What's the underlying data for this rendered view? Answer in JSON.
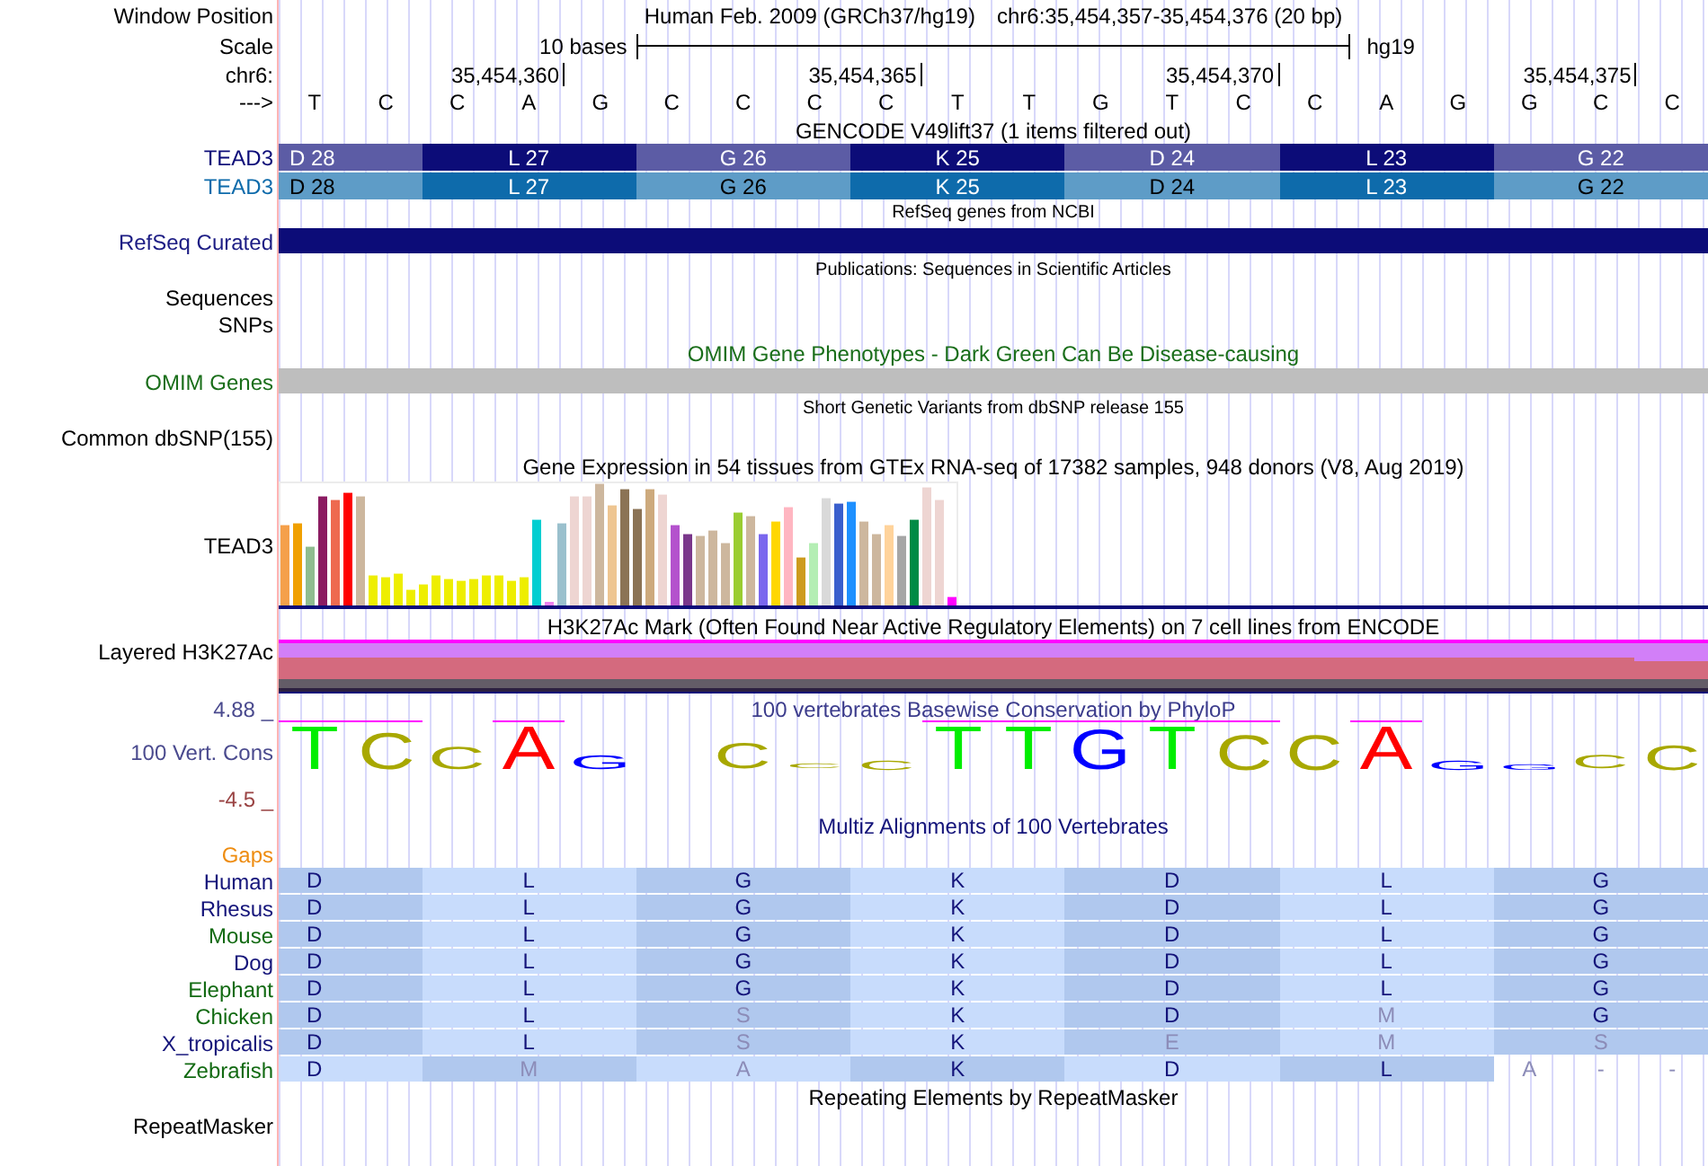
{
  "header": {
    "label": "Window Position",
    "assembly": "Human Feb. 2009 (GRCh37/hg19)",
    "position": "chr6:35,454,357-35,454,376 (20 bp)"
  },
  "scale": {
    "label": "Scale",
    "length": "10 bases",
    "genome": "hg19"
  },
  "coordinates": {
    "label": "chr6:",
    "ticks": [
      "35,454,360",
      "35,454,365",
      "35,454,370",
      "35,454,375"
    ]
  },
  "sequence": {
    "label": "--->",
    "bases": [
      "T",
      "C",
      "C",
      "A",
      "G",
      "C",
      "C",
      "C",
      "C",
      "T",
      "T",
      "G",
      "T",
      "C",
      "C",
      "A",
      "G",
      "G",
      "C",
      "C"
    ]
  },
  "gencode": {
    "title": "GENCODE V49lift37 (1 items filtered out)",
    "transcripts": [
      {
        "name": "TEAD3",
        "color": "#0c0c78",
        "codons": [
          "D 28",
          "L 27",
          "G 26",
          "K 25",
          "D 24",
          "L 23",
          "G 22"
        ]
      },
      {
        "name": "TEAD3",
        "color": "#0e6bab",
        "codons": [
          "D 28",
          "L 27",
          "G 26",
          "K 25",
          "D 24",
          "L 23",
          "G 22"
        ]
      }
    ]
  },
  "refseq": {
    "title": "RefSeq genes from NCBI",
    "label": "RefSeq Curated"
  },
  "publications": {
    "title": "Publications: Sequences in Scientific Articles",
    "labels": [
      "Sequences",
      "SNPs"
    ]
  },
  "omim": {
    "title": "OMIM Gene Phenotypes - Dark Green Can Be Disease-causing",
    "label": "OMIM Genes"
  },
  "dbsnp": {
    "title": "Short Genetic Variants from dbSNP release 155",
    "label": "Common dbSNP(155)"
  },
  "gtex": {
    "title": "Gene Expression in 54 tissues from GTEx RNA-seq of 17382 samples, 948 donors (V8, Aug 2019)",
    "label": "TEAD3"
  },
  "h3k27ac": {
    "title": "H3K27Ac Mark (Often Found Near Active Regulatory Elements) on 7 cell lines from ENCODE",
    "label": "Layered H3K27Ac"
  },
  "phylop": {
    "title": "100 vertebrates Basewise Conservation by PhyloP",
    "label": "100 Vert. Cons",
    "max_label": "4.88 _",
    "min_label": "-4.5 _",
    "logo": [
      {
        "base": "T",
        "color": "#00ee00"
      },
      {
        "base": "C",
        "color": "#a8a800"
      },
      {
        "base": "C",
        "color": "#a8a800"
      },
      {
        "base": "A",
        "color": "#ff0000"
      },
      {
        "base": "G",
        "color": "#0000ff"
      },
      {
        "base": "C",
        "color": "#a8a800"
      },
      {
        "base": "C",
        "color": "#a8a800"
      },
      {
        "base": "C",
        "color": "#a8a800"
      },
      {
        "base": "T",
        "color": "#00ee00"
      },
      {
        "base": "T",
        "color": "#00ee00"
      },
      {
        "base": "G",
        "color": "#0000ff"
      },
      {
        "base": "T",
        "color": "#00ee00"
      },
      {
        "base": "C",
        "color": "#a8a800"
      },
      {
        "base": "C",
        "color": "#a8a800"
      },
      {
        "base": "A",
        "color": "#ff0000"
      },
      {
        "base": "G",
        "color": "#0000ff"
      },
      {
        "base": "G",
        "color": "#0000ff"
      },
      {
        "base": "C",
        "color": "#a8a800"
      },
      {
        "base": "C",
        "color": "#a8a800"
      }
    ]
  },
  "multiz": {
    "title": "Multiz Alignments of 100 Vertebrates",
    "gaps_label": "Gaps",
    "species": [
      {
        "name": "Human",
        "color": "#14147a",
        "codons": [
          {
            "aa": "D",
            "match": true
          },
          {
            "aa": "L",
            "match": true
          },
          {
            "aa": "G",
            "match": true
          },
          {
            "aa": "K",
            "match": true
          },
          {
            "aa": "D",
            "match": true
          },
          {
            "aa": "L",
            "match": true
          },
          {
            "aa": "G",
            "match": true
          }
        ]
      },
      {
        "name": "Rhesus",
        "color": "#14147a",
        "codons": [
          {
            "aa": "D",
            "match": true
          },
          {
            "aa": "L",
            "match": true
          },
          {
            "aa": "G",
            "match": true
          },
          {
            "aa": "K",
            "match": true
          },
          {
            "aa": "D",
            "match": true
          },
          {
            "aa": "L",
            "match": true
          },
          {
            "aa": "G",
            "match": true
          }
        ]
      },
      {
        "name": "Mouse",
        "color": "#126a12",
        "codons": [
          {
            "aa": "D",
            "match": true
          },
          {
            "aa": "L",
            "match": true
          },
          {
            "aa": "G",
            "match": true
          },
          {
            "aa": "K",
            "match": true
          },
          {
            "aa": "D",
            "match": true
          },
          {
            "aa": "L",
            "match": true
          },
          {
            "aa": "G",
            "match": true
          }
        ]
      },
      {
        "name": "Dog",
        "color": "#14147a",
        "codons": [
          {
            "aa": "D",
            "match": true
          },
          {
            "aa": "L",
            "match": true
          },
          {
            "aa": "G",
            "match": true
          },
          {
            "aa": "K",
            "match": true
          },
          {
            "aa": "D",
            "match": true
          },
          {
            "aa": "L",
            "match": true
          },
          {
            "aa": "G",
            "match": true
          }
        ]
      },
      {
        "name": "Elephant",
        "color": "#126a12",
        "codons": [
          {
            "aa": "D",
            "match": true
          },
          {
            "aa": "L",
            "match": true
          },
          {
            "aa": "G",
            "match": true
          },
          {
            "aa": "K",
            "match": true
          },
          {
            "aa": "D",
            "match": true
          },
          {
            "aa": "L",
            "match": true
          },
          {
            "aa": "G",
            "match": true
          }
        ]
      },
      {
        "name": "Chicken",
        "color": "#126a12",
        "codons": [
          {
            "aa": "D",
            "match": true
          },
          {
            "aa": "L",
            "match": true
          },
          {
            "aa": "S",
            "match": false
          },
          {
            "aa": "K",
            "match": true
          },
          {
            "aa": "D",
            "match": true
          },
          {
            "aa": "M",
            "match": false
          },
          {
            "aa": "G",
            "match": true
          }
        ]
      },
      {
        "name": "X_tropicalis",
        "color": "#14147a",
        "codons": [
          {
            "aa": "D",
            "match": true
          },
          {
            "aa": "L",
            "match": true
          },
          {
            "aa": "S",
            "match": false
          },
          {
            "aa": "K",
            "match": true
          },
          {
            "aa": "E",
            "match": false
          },
          {
            "aa": "M",
            "match": false
          },
          {
            "aa": "S",
            "match": false
          }
        ]
      },
      {
        "name": "Zebrafish",
        "color": "#126a12",
        "codons": [
          {
            "aa": "D",
            "match": true
          },
          {
            "aa": "M",
            "match": false
          },
          {
            "aa": "A",
            "match": false
          },
          {
            "aa": "K",
            "match": true
          },
          {
            "aa": "D",
            "match": true
          },
          {
            "aa": "L",
            "match": true
          }
        ],
        "bases": [
          {
            "base": "A",
            "match": false
          },
          {
            "base": "-",
            "match": false
          },
          {
            "base": "-",
            "match": false
          }
        ]
      }
    ]
  },
  "repeatmasker": {
    "title": "Repeating Elements by RepeatMasker",
    "label": "RepeatMasker"
  }
}
